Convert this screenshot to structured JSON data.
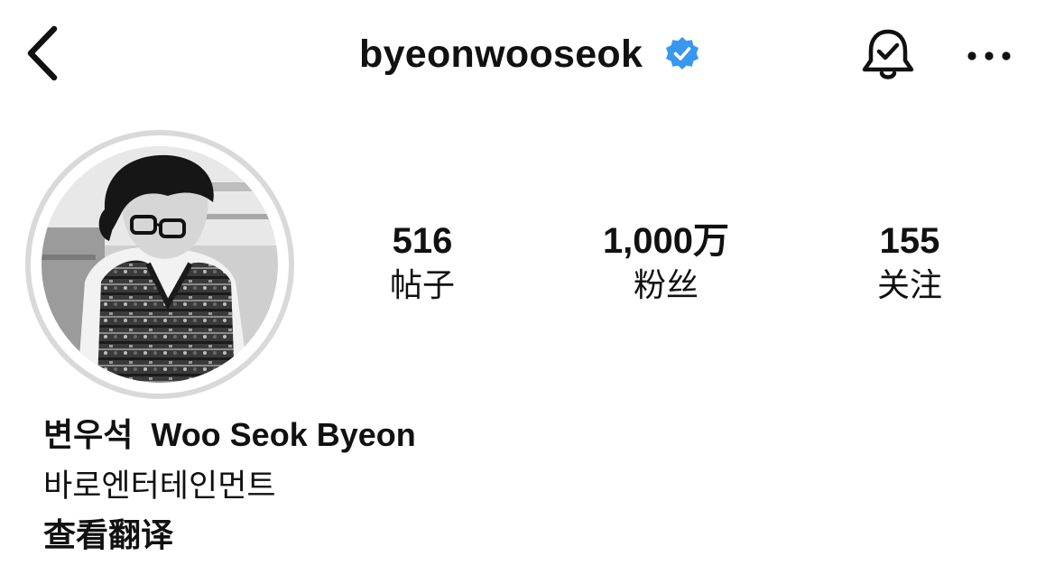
{
  "header": {
    "username": "byeonwooseok",
    "verified_color": "#3897f0",
    "back_icon": "chevron-left-icon",
    "bell_icon": "bell-check-icon",
    "more_icon": "more-horizontal-icon"
  },
  "profile": {
    "avatar_desc": "avatar",
    "stats": {
      "posts": {
        "count": "516",
        "label": "帖子"
      },
      "followers": {
        "count": "1,000万",
        "label": "粉丝"
      },
      "following": {
        "count": "155",
        "label": "关注"
      }
    },
    "display_name": "변우석  Woo Seok Byeon",
    "bio": "바로엔터테인먼트",
    "translate_label": "查看翻译"
  }
}
